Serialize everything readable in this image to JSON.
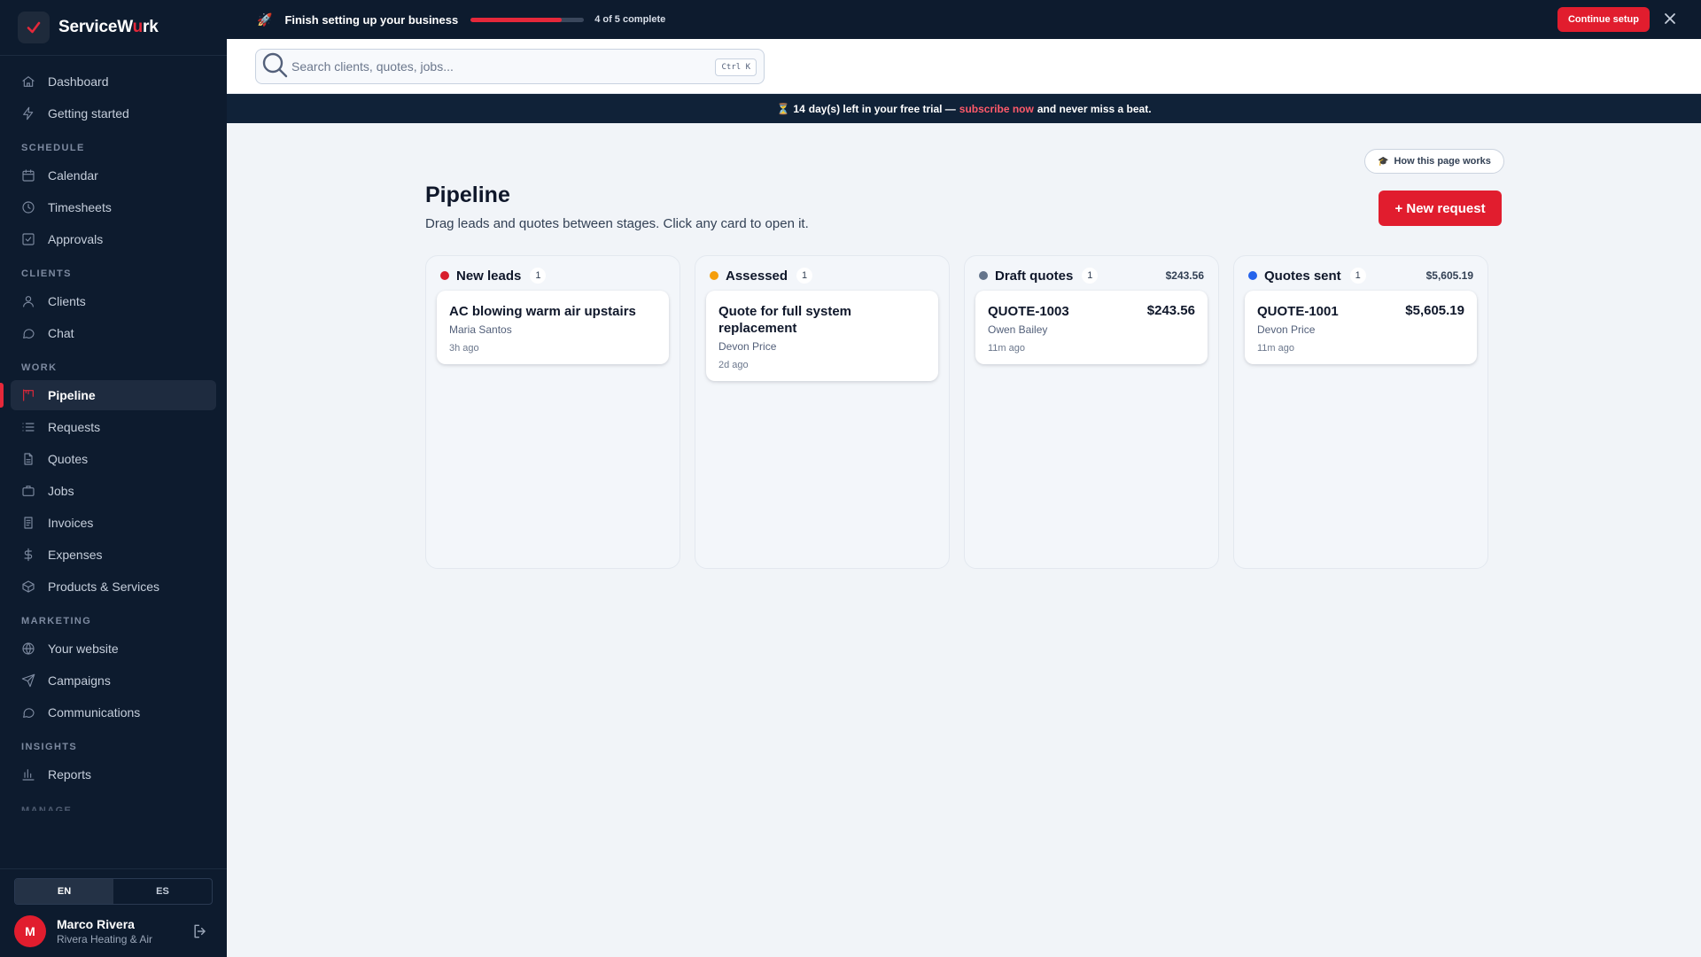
{
  "brand": {
    "name_main": "ServiceW",
    "name_accent": "u",
    "name_end": "rk"
  },
  "nav": [
    {
      "type": "item",
      "name": "nav-dashboard",
      "icon": "home-icon",
      "label": "Dashboard"
    },
    {
      "type": "item",
      "name": "nav-getting-started",
      "icon": "lightning-icon",
      "label": "Getting started"
    },
    {
      "type": "section",
      "label": "SCHEDULE"
    },
    {
      "type": "item",
      "name": "nav-calendar",
      "icon": "calendar-icon",
      "label": "Calendar"
    },
    {
      "type": "item",
      "name": "nav-timesheets",
      "icon": "clock-icon",
      "label": "Timesheets"
    },
    {
      "type": "item",
      "name": "nav-approvals",
      "icon": "check-square-icon",
      "label": "Approvals"
    },
    {
      "type": "section",
      "label": "CLIENTS"
    },
    {
      "type": "item",
      "name": "nav-clients",
      "icon": "user-icon",
      "label": "Clients"
    },
    {
      "type": "item",
      "name": "nav-chat",
      "icon": "chat-icon",
      "label": "Chat"
    },
    {
      "type": "section",
      "label": "WORK"
    },
    {
      "type": "item",
      "name": "nav-pipeline",
      "icon": "pipeline-icon",
      "label": "Pipeline",
      "active": true
    },
    {
      "type": "item",
      "name": "nav-requests",
      "icon": "list-icon",
      "label": "Requests"
    },
    {
      "type": "item",
      "name": "nav-quotes",
      "icon": "document-icon",
      "label": "Quotes"
    },
    {
      "type": "item",
      "name": "nav-jobs",
      "icon": "briefcase-icon",
      "label": "Jobs"
    },
    {
      "type": "item",
      "name": "nav-invoices",
      "icon": "invoice-icon",
      "label": "Invoices"
    },
    {
      "type": "item",
      "name": "nav-expenses",
      "icon": "dollar-icon",
      "label": "Expenses"
    },
    {
      "type": "item",
      "name": "nav-products-services",
      "icon": "box-icon",
      "label": "Products & Services"
    },
    {
      "type": "section",
      "label": "MARKETING"
    },
    {
      "type": "item",
      "name": "nav-your-website",
      "icon": "globe-icon",
      "label": "Your website"
    },
    {
      "type": "item",
      "name": "nav-campaigns",
      "icon": "send-icon",
      "label": "Campaigns"
    },
    {
      "type": "item",
      "name": "nav-communications",
      "icon": "chat-icon",
      "label": "Communications"
    },
    {
      "type": "section",
      "label": "INSIGHTS"
    },
    {
      "type": "item",
      "name": "nav-reports",
      "icon": "bar-chart-icon",
      "label": "Reports"
    }
  ],
  "nav_cut_section": "MANAGE",
  "language": {
    "en": "EN",
    "es": "ES",
    "selected": "EN"
  },
  "user": {
    "initial": "M",
    "name": "Marco Rivera",
    "company": "Rivera Heating & Air"
  },
  "setup_banner": {
    "title": "Finish setting up your business",
    "progress": 0.8,
    "count_text": "4 of 5 complete",
    "cta": "Continue setup",
    "accent": "#e11d2e"
  },
  "search": {
    "placeholder": "Search clients, quotes, jobs...",
    "value": "",
    "shortcut": "Ctrl K"
  },
  "trial": {
    "days": "14",
    "text_a": "day(s) left in your free trial —",
    "link": "subscribe now",
    "text_b": "and never miss a beat."
  },
  "page": {
    "help_label": "How this page works",
    "title": "Pipeline",
    "subtitle": "Drag leads and quotes between stages. Click any card to open it.",
    "new_button": "+ New request"
  },
  "columns": [
    {
      "name": "New leads",
      "count": "1",
      "total": "",
      "color": "#d81e2c",
      "cards": [
        {
          "title": "AC blowing warm air upstairs",
          "amount": "",
          "client": "Maria Santos",
          "time": "3h ago"
        }
      ]
    },
    {
      "name": "Assessed",
      "count": "1",
      "total": "",
      "color": "#f59e0b",
      "cards": [
        {
          "title": "Quote for full system replacement",
          "amount": "",
          "client": "Devon Price",
          "time": "2d ago"
        }
      ]
    },
    {
      "name": "Draft quotes",
      "count": "1",
      "total": "$243.56",
      "color": "#64748b",
      "cards": [
        {
          "title": "QUOTE-1003",
          "amount": "$243.56",
          "client": "Owen Bailey",
          "time": "11m ago"
        }
      ]
    },
    {
      "name": "Quotes sent",
      "count": "1",
      "total": "$5,605.19",
      "color": "#2563eb",
      "cards": [
        {
          "title": "QUOTE-1001",
          "amount": "$5,605.19",
          "client": "Devon Price",
          "time": "11m ago"
        }
      ]
    }
  ]
}
